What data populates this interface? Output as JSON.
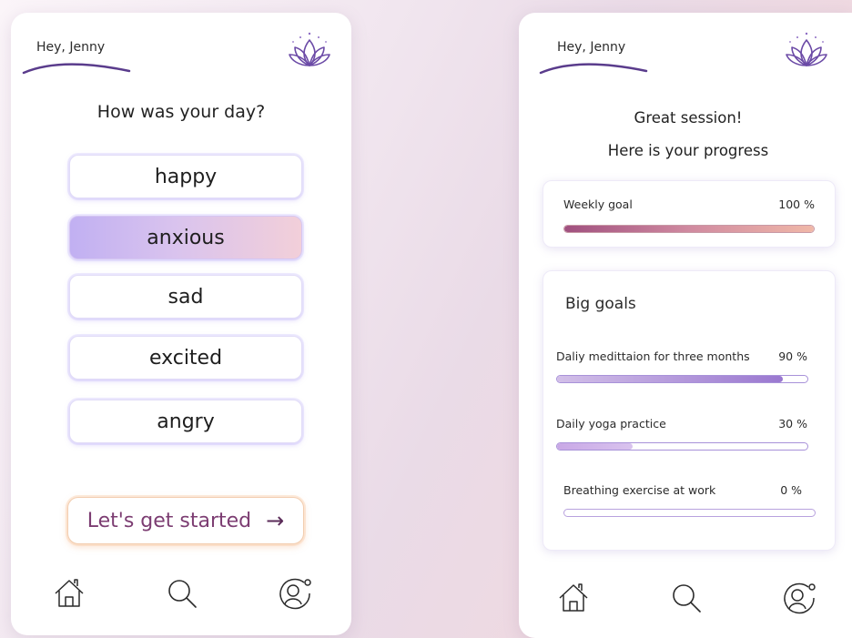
{
  "colors": {
    "accent_purple": "#7b5ab8",
    "start_text": "#7c3d72",
    "selected_gradient_start": "#c1b0f2",
    "selected_gradient_end": "#f2cfd9"
  },
  "left_screen": {
    "greeting": "Hey,  Jenny",
    "question": "How was your day?",
    "moods": [
      {
        "label": "happy",
        "selected": false
      },
      {
        "label": "anxious",
        "selected": true
      },
      {
        "label": "sad",
        "selected": false
      },
      {
        "label": "excited",
        "selected": false
      },
      {
        "label": "angry",
        "selected": false
      }
    ],
    "start_button": {
      "label": "Let's get started",
      "icon": "arrow-right-icon"
    },
    "nav": [
      "home-icon",
      "search-icon",
      "profile-icon"
    ]
  },
  "right_screen": {
    "greeting": "Hey,  Jenny",
    "heading_line1": "Great session!",
    "heading_line2": "Here is your progress",
    "weekly_goal": {
      "label": "Weekly goal",
      "value_text": "100 %",
      "progress": 1.0
    },
    "big_goals": {
      "title": "Big goals",
      "items": [
        {
          "label": "Daliy medittaion for three months",
          "value_text": "90 %",
          "progress": 0.9
        },
        {
          "label": "Daily yoga practice",
          "value_text": "30 %",
          "progress": 0.3
        },
        {
          "label": "Breathing exercise at work",
          "value_text": "0 %",
          "progress": 0.0
        }
      ]
    },
    "nav": [
      "home-icon",
      "search-icon",
      "profile-icon"
    ]
  }
}
